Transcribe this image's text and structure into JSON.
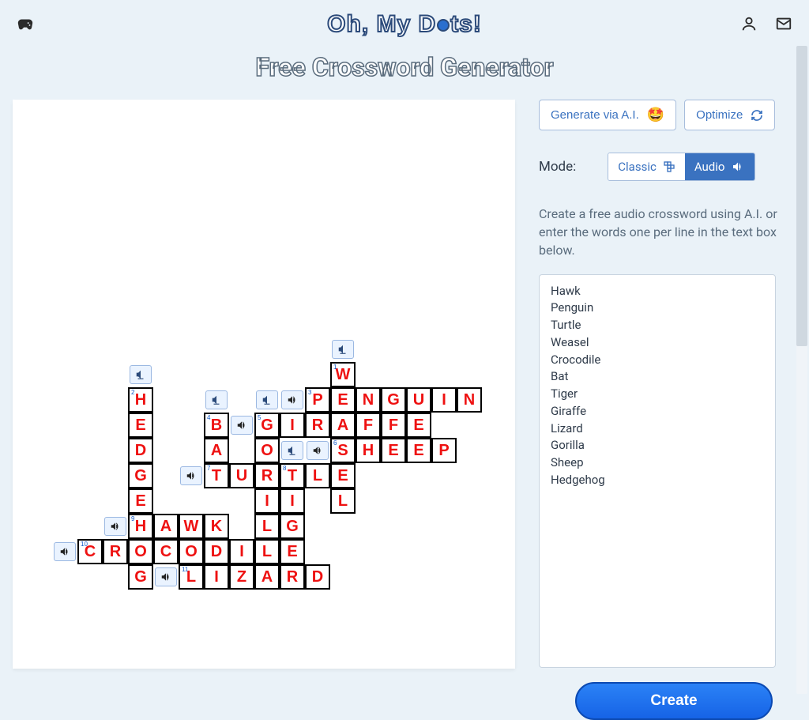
{
  "logo_parts": {
    "l1": "Oh, My D",
    "l2": "ts!"
  },
  "page_title": "Free Crossword Generator",
  "buttons": {
    "generate_ai": "Generate via A.I.",
    "generate_emoji": "🤩",
    "optimize": "Optimize"
  },
  "mode": {
    "label": "Mode:",
    "classic": "Classic",
    "audio": "Audio",
    "selected": "Audio"
  },
  "description": "Create a free audio crossword using A.I. or enter the words one per line in the text box below.",
  "words_text": "Hawk\nPenguin\nTurtle\nWeasel\nCrocodile\nBat\nTiger\nGiraffe\nLizard\nGorilla\nSheep\nHedgehog",
  "create_label": "Create",
  "crossword": {
    "cells": [
      {
        "col": 11,
        "row": 1,
        "num": "1",
        "letter": "W"
      },
      {
        "col": 3,
        "row": 2,
        "num": "2",
        "letter": "H"
      },
      {
        "col": 11,
        "row": 2,
        "letter": "E"
      },
      {
        "col": 10,
        "row": 2,
        "num": "3",
        "letter": "P"
      },
      {
        "col": 12,
        "row": 2,
        "letter": "N"
      },
      {
        "col": 13,
        "row": 2,
        "letter": "G"
      },
      {
        "col": 14,
        "row": 2,
        "letter": "U"
      },
      {
        "col": 15,
        "row": 2,
        "letter": "I"
      },
      {
        "col": 16,
        "row": 2,
        "letter": "N"
      },
      {
        "col": 3,
        "row": 3,
        "letter": "E"
      },
      {
        "col": 6,
        "row": 3,
        "num": "4",
        "letter": "B"
      },
      {
        "col": 8,
        "row": 3,
        "num": "5",
        "letter": "G"
      },
      {
        "col": 9,
        "row": 3,
        "letter": "I"
      },
      {
        "col": 10,
        "row": 3,
        "letter": "R"
      },
      {
        "col": 11,
        "row": 3,
        "letter": "A"
      },
      {
        "col": 12,
        "row": 3,
        "letter": "F"
      },
      {
        "col": 13,
        "row": 3,
        "letter": "F"
      },
      {
        "col": 14,
        "row": 3,
        "letter": "E"
      },
      {
        "col": 3,
        "row": 4,
        "letter": "D"
      },
      {
        "col": 6,
        "row": 4,
        "letter": "A"
      },
      {
        "col": 8,
        "row": 4,
        "letter": "O"
      },
      {
        "col": 11,
        "row": 4,
        "num": "6",
        "letter": "S"
      },
      {
        "col": 12,
        "row": 4,
        "letter": "H"
      },
      {
        "col": 13,
        "row": 4,
        "letter": "E"
      },
      {
        "col": 14,
        "row": 4,
        "letter": "E"
      },
      {
        "col": 15,
        "row": 4,
        "letter": "P"
      },
      {
        "col": 3,
        "row": 5,
        "letter": "G"
      },
      {
        "col": 6,
        "row": 5,
        "num": "7",
        "letter": "T"
      },
      {
        "col": 7,
        "row": 5,
        "letter": "U"
      },
      {
        "col": 8,
        "row": 5,
        "letter": "R"
      },
      {
        "col": 9,
        "row": 5,
        "num": "8",
        "letter": "T"
      },
      {
        "col": 10,
        "row": 5,
        "letter": "L"
      },
      {
        "col": 11,
        "row": 5,
        "letter": "E"
      },
      {
        "col": 3,
        "row": 6,
        "letter": "E"
      },
      {
        "col": 8,
        "row": 6,
        "letter": "I"
      },
      {
        "col": 9,
        "row": 6,
        "letter": "I"
      },
      {
        "col": 11,
        "row": 6,
        "letter": "L"
      },
      {
        "col": 3,
        "row": 7,
        "num": "9",
        "letter": "H"
      },
      {
        "col": 4,
        "row": 7,
        "letter": "A"
      },
      {
        "col": 5,
        "row": 7,
        "letter": "W"
      },
      {
        "col": 6,
        "row": 7,
        "letter": "K"
      },
      {
        "col": 8,
        "row": 7,
        "letter": "L"
      },
      {
        "col": 9,
        "row": 7,
        "letter": "G"
      },
      {
        "col": 1,
        "row": 8,
        "num": "10",
        "letter": "C"
      },
      {
        "col": 2,
        "row": 8,
        "letter": "R"
      },
      {
        "col": 3,
        "row": 8,
        "letter": "O"
      },
      {
        "col": 4,
        "row": 8,
        "letter": "C"
      },
      {
        "col": 5,
        "row": 8,
        "letter": "O"
      },
      {
        "col": 6,
        "row": 8,
        "letter": "D"
      },
      {
        "col": 7,
        "row": 8,
        "letter": "I"
      },
      {
        "col": 8,
        "row": 8,
        "letter": "L"
      },
      {
        "col": 9,
        "row": 8,
        "letter": "E"
      },
      {
        "col": 3,
        "row": 9,
        "letter": "G"
      },
      {
        "col": 5,
        "row": 9,
        "num": "11",
        "letter": "L"
      },
      {
        "col": 6,
        "row": 9,
        "letter": "I"
      },
      {
        "col": 7,
        "row": 9,
        "letter": "Z"
      },
      {
        "col": 8,
        "row": 9,
        "letter": "A"
      },
      {
        "col": 9,
        "row": 9,
        "letter": "R"
      },
      {
        "col": 10,
        "row": 9,
        "letter": "D"
      }
    ],
    "speakers": [
      {
        "col": 11,
        "row": 0,
        "type": "down"
      },
      {
        "col": 3,
        "row": 1,
        "type": "down"
      },
      {
        "col": 6,
        "row": 2,
        "type": "down"
      },
      {
        "col": 8,
        "row": 2,
        "type": "down"
      },
      {
        "col": 9,
        "row": 2,
        "type": "across"
      },
      {
        "col": 7,
        "row": 3,
        "type": "across"
      },
      {
        "col": 9,
        "row": 4,
        "type": "down"
      },
      {
        "col": 10,
        "row": 4,
        "type": "across"
      },
      {
        "col": 5,
        "row": 5,
        "type": "across"
      },
      {
        "col": 2,
        "row": 7,
        "type": "across"
      },
      {
        "col": 0,
        "row": 8,
        "type": "across"
      },
      {
        "col": 4,
        "row": 9,
        "type": "across"
      }
    ]
  }
}
